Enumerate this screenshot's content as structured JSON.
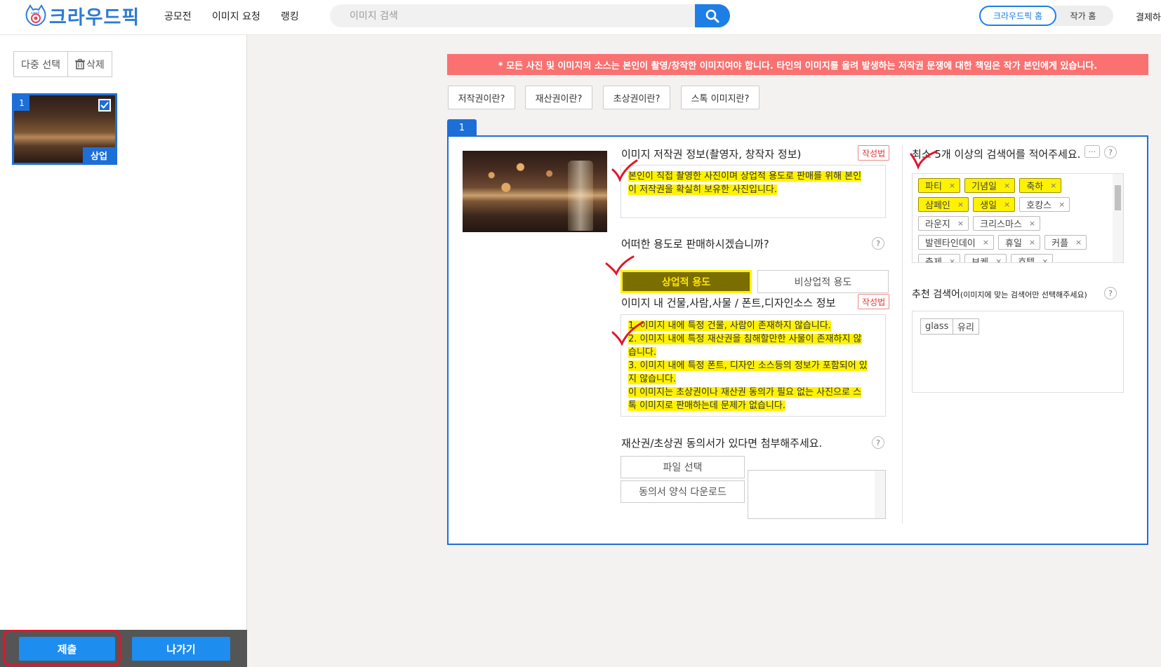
{
  "header": {
    "logo_text": "크라우드픽",
    "nav": [
      "공모전",
      "이미지 요청",
      "랭킹"
    ],
    "search_placeholder": "이미지 검색",
    "home_button": "크라우드픽 홈",
    "author_home": "작가 홈",
    "pay_link": "결제하"
  },
  "sidebar": {
    "multi_select": "다중 선택",
    "delete": "삭제",
    "thumb_index": "1",
    "thumb_badge": "상업",
    "submit": "제출",
    "exit": "나가기"
  },
  "warning": "* 모든 사진 및 이미지의 소스는 본인이 촬영/창작한 이미지여야 합니다. 타인의 이미지를 올려 발생하는 저작권 문쟁에 대한 책임은 작가 본인에게 있습니다.",
  "info_buttons": [
    "저작권이란?",
    "재산권이란?",
    "초상권이란?",
    "스톡 이미지란?"
  ],
  "panel": {
    "tab": "1",
    "copyright_label": "이미지 저작권 정보(촬영자, 창작자 정보)",
    "write_tag": "작성법",
    "copyright_text_1": "본인이 직접 촬영한 사진이며 상업적 용도로 판매를 위해 본인",
    "copyright_text_2": "이 저작권을 확실히 보유한 사진입니다.",
    "usage_label": "어떠한 용도로 판매하시겠습니까?",
    "usage_commercial": "상업적 용도",
    "usage_noncommercial": "비상업적 용도",
    "source_label": "이미지 내 건물,사람,사물 / 폰트,디자인소스 정보",
    "source_lines": [
      "1. 이미지 내에 특정 건물, 사람이 존재하지 않습니다.",
      "2. 이미지 내에 특정 재산권을 침해할만한 사물이 존재하지 않",
      "습니다.",
      "3. 이미지 내에 특정 폰트, 디자인 소스등의 정보가 포함되어 있",
      "지 않습니다.",
      "이 이미지는 초상권이나 재산권 동의가 필요 없는 사진으로 스",
      "톡 이미지로 판매하는데 문제가 없습니다."
    ],
    "consent_label": "재산권/초상권 동의서가 있다면 첨부해주세요.",
    "file_select": "파일 선택",
    "consent_download": "동의서 양식 다운로드",
    "keywords_label": "최소 5개 이상의 검색어를 적어주세요.",
    "more_button": "···",
    "help_mark": "?",
    "keywords": [
      {
        "text": "파티",
        "hl": true
      },
      {
        "text": "기념일",
        "hl": true
      },
      {
        "text": "축하",
        "hl": true
      },
      {
        "text": "샴페인",
        "hl": true
      },
      {
        "text": "생일",
        "hl": true
      },
      {
        "text": "호캉스",
        "hl": false
      },
      {
        "text": "라운지",
        "hl": false
      },
      {
        "text": "크리스마스",
        "hl": false
      },
      {
        "text": "발렌타인데이",
        "hl": false
      },
      {
        "text": "휴일",
        "hl": false
      },
      {
        "text": "커플",
        "hl": false
      },
      {
        "text": "축제",
        "hl": false
      },
      {
        "text": "보케",
        "hl": false
      },
      {
        "text": "호텔",
        "hl": false
      }
    ],
    "tag_remove": "×",
    "rec_label": "추천 검색어",
    "rec_hint": "(이미지에 맞는 검색어만 선택해주세요)",
    "rec_tags": [
      "glass",
      "유리"
    ]
  },
  "colors": {
    "brand_blue": "#1d6fd8",
    "warning_red": "#f97170",
    "highlight": "#fff200",
    "annotation_red": "#e0162b"
  }
}
